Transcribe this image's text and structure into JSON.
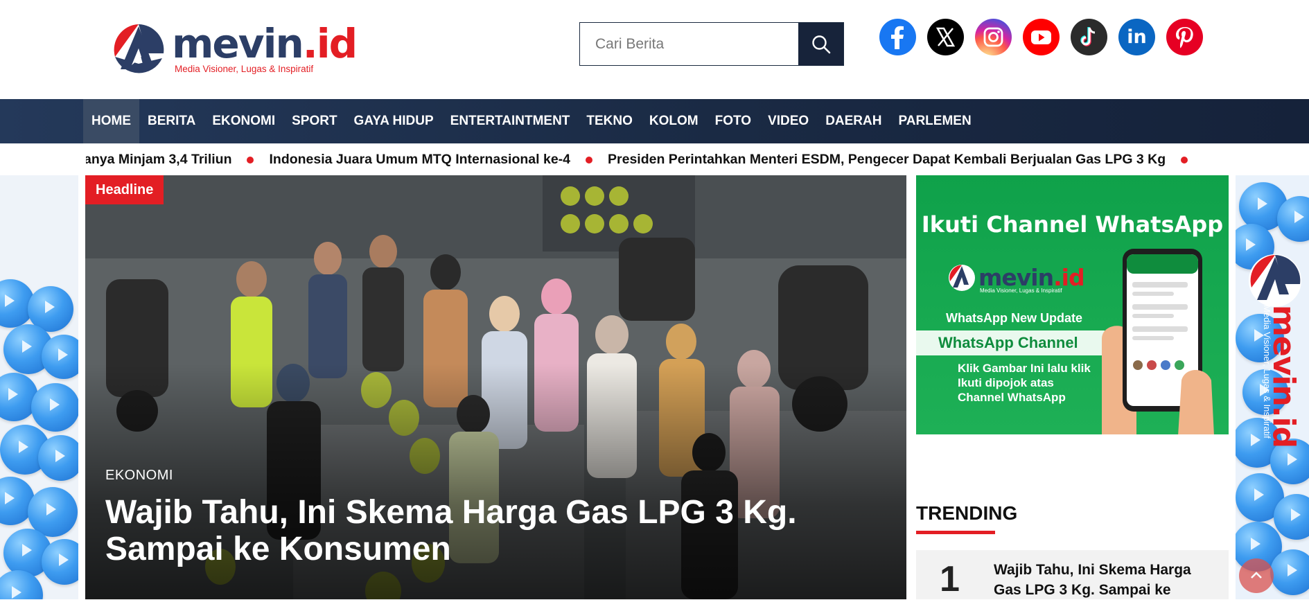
{
  "brand": {
    "name": "mevin",
    "tld": ".id",
    "tagline": "Media Visioner, Lugas & Inspiratif",
    "accent_color": "#e31e24",
    "navy_color": "#1a2a44"
  },
  "search": {
    "placeholder": "Cari Berita",
    "icon": "search-icon"
  },
  "social": [
    {
      "name": "facebook-icon",
      "color": "#1877f2",
      "glyph": "f"
    },
    {
      "name": "x-icon",
      "color": "#000000",
      "glyph": "𝕏"
    },
    {
      "name": "instagram-icon",
      "color": "#d6249f",
      "glyph": ""
    },
    {
      "name": "youtube-icon",
      "color": "#ff0000",
      "glyph": ""
    },
    {
      "name": "tiktok-icon",
      "color": "#2b2b2b",
      "glyph": "♪"
    },
    {
      "name": "linkedin-icon",
      "color": "#0a66c2",
      "glyph": "in"
    },
    {
      "name": "pinterest-icon",
      "color": "#e60023",
      "glyph": "P"
    }
  ],
  "nav": {
    "items": [
      "HOME",
      "BERITA",
      "EKONOMI",
      "SPORT",
      "GAYA HIDUP",
      "ENTERTAINTMENT",
      "TEKNO",
      "KOLOM",
      "FOTO",
      "VIDEO",
      "DAERAH",
      "PARLEMEN"
    ],
    "active": "HOME"
  },
  "ticker": {
    "items": [
      "anya Minjam 3,4 Triliun",
      "Indonesia Juara Umum MTQ Internasional ke-4",
      "Presiden Perintahkan Menteri ESDM, Pengecer Dapat Kembali Berjualan Gas LPG 3 Kg"
    ]
  },
  "headline": {
    "badge": "Headline",
    "category": "EKONOMI",
    "title": "Wajib Tahu, Ini Skema Harga Gas LPG 3 Kg. Sampai ke Konsumen"
  },
  "promo": {
    "title": "Ikuti Channel WhatsApp",
    "update": "WhatsApp New Update",
    "channel": "WhatsApp Channel",
    "instructions": "Klik Gambar Ini lalu klik Ikuti dipojok atas Channel WhatsApp"
  },
  "trending": {
    "heading": "TRENDING",
    "items": [
      {
        "rank": "1",
        "title": "Wajib Tahu, Ini Skema Harga Gas LPG 3 Kg. Sampai ke"
      }
    ]
  }
}
